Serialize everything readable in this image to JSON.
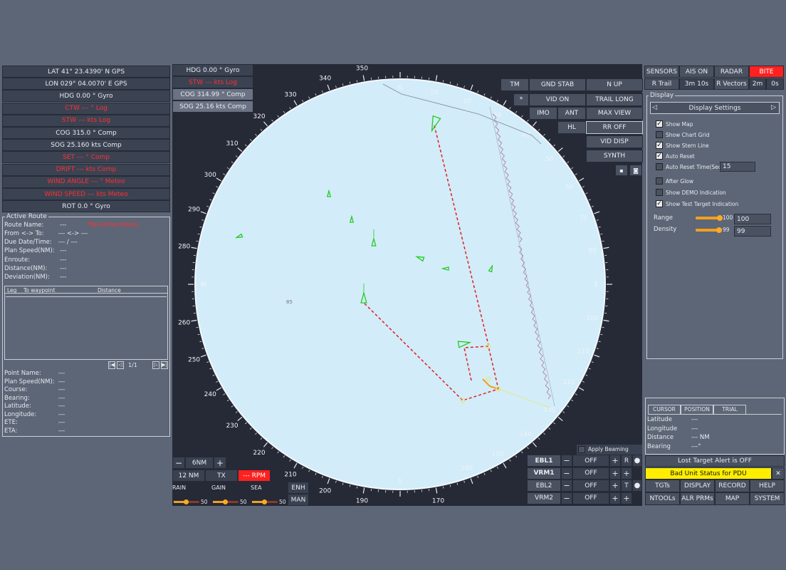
{
  "nav_info": [
    {
      "text": "LAT 41° 23.4390' N  GPS",
      "alert": false
    },
    {
      "text": "LON 029° 04.0070' E  GPS",
      "alert": false
    },
    {
      "text": "HDG  0.00 °   Gyro",
      "alert": false
    },
    {
      "text": "CTW  --- °   Log",
      "alert": true
    },
    {
      "text": "STW  --- kts   Log",
      "alert": true
    },
    {
      "text": "COG  315.0 °   Comp",
      "alert": false
    },
    {
      "text": "SOG  25.160 kts  Comp",
      "alert": false
    },
    {
      "text": "SET  --- °   Comp",
      "alert": true
    },
    {
      "text": "DRIFT  --- kts   Comp",
      "alert": true
    },
    {
      "text": "WIND ANGLE  --- °   Meteo",
      "alert": true
    },
    {
      "text": "WIND SPEED  --- kts  Meteo",
      "alert": true
    },
    {
      "text": "ROT  0.0 °   Gyro",
      "alert": false
    }
  ],
  "active_route": {
    "title": "Active Route",
    "route_name_label": "Route Name:",
    "route_name_value": "---",
    "route_status": "*No Active Route",
    "from_to_label": "From <-> To:",
    "from_to_value": "--- <-> ---",
    "due_label": "Due Date/Time:",
    "due_value": "---    /    ---",
    "plan_speed_label": "Plan Speed(NM):",
    "plan_speed_value": "---",
    "enroute_label": "Enroute:",
    "enroute_value": "---",
    "distance_label": "Distance(NM):",
    "distance_value": "---",
    "deviation_label": "Deviation(NM):",
    "deviation_value": "---",
    "table_headers": [
      "Leg",
      "To waypoint",
      "Distance"
    ],
    "page": "1/1"
  },
  "point_info": [
    {
      "label": "Point Name:",
      "value": "---"
    },
    {
      "label": "Plan Speed(NM):",
      "value": "---"
    },
    {
      "label": "Course:",
      "value": "---"
    },
    {
      "label": "Bearing:",
      "value": "---"
    },
    {
      "label": "Latitude:",
      "value": "---"
    },
    {
      "label": "Longitude:",
      "value": "---"
    },
    {
      "label": "ETE:",
      "value": "---"
    },
    {
      "label": "ETA:",
      "value": "---"
    }
  ],
  "radar_top_left": {
    "hdg": "HDG  0.00 °      Gyro",
    "stw": "STW  --- kts       Log",
    "cog": "COG  314.99 °   Comp",
    "sog": "SOG  25.16 kts   Comp"
  },
  "radar_buttons": {
    "tm": "TM",
    "gnd_stab": "GND STAB",
    "n_up": "N UP",
    "star": "*",
    "vid_on": "VID ON",
    "trail_long": "TRAIL LONG",
    "imo": "IMO",
    "ant": "ANT",
    "max_view": "MAX VIEW",
    "hl": "HL",
    "rr_off": "RR OFF",
    "vid_disp": "VID DISP",
    "synth": "SYNTH"
  },
  "bearing_labels": [
    "340",
    "350",
    "N",
    "10",
    "20",
    "30",
    "40",
    "50",
    "60",
    "70",
    "80",
    "E",
    "100",
    "110",
    "120",
    "130",
    "140",
    "150",
    "160",
    "170",
    "S",
    "190",
    "200",
    "210",
    "220",
    "230",
    "240",
    "250",
    "260",
    "W",
    "280",
    "290",
    "300",
    "310",
    "320",
    "330"
  ],
  "range_scale": "85",
  "range_controls": {
    "minus": "−",
    "range": "6NM",
    "plus": "+",
    "range2": "12 NM",
    "tx": "TX",
    "rpm": "--- RPM"
  },
  "gain_controls": [
    {
      "label": "RAIN",
      "value": "50",
      "level": 0.5
    },
    {
      "label": "GAIN",
      "value": "50",
      "level": 0.5
    },
    {
      "label": "SEA",
      "value": "50",
      "level": 0.5
    }
  ],
  "enh_label": "ENH",
  "man_label": "MAN",
  "apply_beaming": "Apply Beaming",
  "ebl_vrm": [
    {
      "label": "EBL1",
      "value": "OFF",
      "bold": true,
      "extra": "R"
    },
    {
      "label": "VRM1",
      "value": "OFF",
      "bold": true,
      "extra": ""
    },
    {
      "label": "EBL2",
      "value": "OFF",
      "bold": false,
      "extra": "T"
    },
    {
      "label": "VRM2",
      "value": "OFF",
      "bold": false,
      "extra": ""
    }
  ],
  "top_right_tabs": {
    "sensors": "SENSORS",
    "ais_on": "AIS ON",
    "radar": "RADAR",
    "bite": "BITE"
  },
  "trails": {
    "r_trail": "R Trail",
    "trail_time": "3m 10s",
    "r_vectors": "R Vectors",
    "vec_time": "2m",
    "vec_time2": "0s"
  },
  "display_panel": {
    "title": "Display",
    "header": "Display Settings",
    "options": [
      {
        "label": "Show Map",
        "checked": true
      },
      {
        "label": "Show Chart Grid",
        "checked": false
      },
      {
        "label": "Show Stern Line",
        "checked": true
      },
      {
        "label": "Auto Reset",
        "checked": true
      },
      {
        "label": "Auto Reset Time(Sec)",
        "checked": false,
        "input": "15"
      },
      {
        "label": "After Glow",
        "checked": false
      },
      {
        "label": "Show DEMO Indication",
        "checked": false
      },
      {
        "label": "Show Test Target Indication",
        "checked": true
      }
    ],
    "range_label": "Range",
    "range_slider": "100",
    "range_input": "100",
    "range_level": 1.0,
    "density_label": "Density",
    "density_slider": "99",
    "density_input": "99",
    "density_level": 0.99
  },
  "cursor_panel": {
    "tabs": [
      "CURSOR",
      "POSITION",
      "TRIAL"
    ],
    "rows": [
      {
        "label": "Latitude",
        "value": "---"
      },
      {
        "label": "Longitude",
        "value": "---"
      },
      {
        "label": "Distance",
        "value": "--- NM"
      },
      {
        "label": "Bearing",
        "value": "---°"
      }
    ]
  },
  "alerts": {
    "lost_target": "Lost Target Alert is OFF",
    "bad_unit": "Bad Unit Status for PDU"
  },
  "bottom_menu": [
    [
      "TGTs",
      "DISPLAY",
      "RECORD",
      "HELP"
    ],
    [
      "NTOOLs",
      "ALR PRMs",
      "MAP",
      "SYSTEM"
    ]
  ],
  "colors": {
    "background": "#5d6676",
    "radar_bg": "#d2ecf9",
    "alert_red": "#ff3030",
    "warning_yellow": "#ffee00",
    "target_green": "#22cc22",
    "route_red": "#e02020"
  }
}
